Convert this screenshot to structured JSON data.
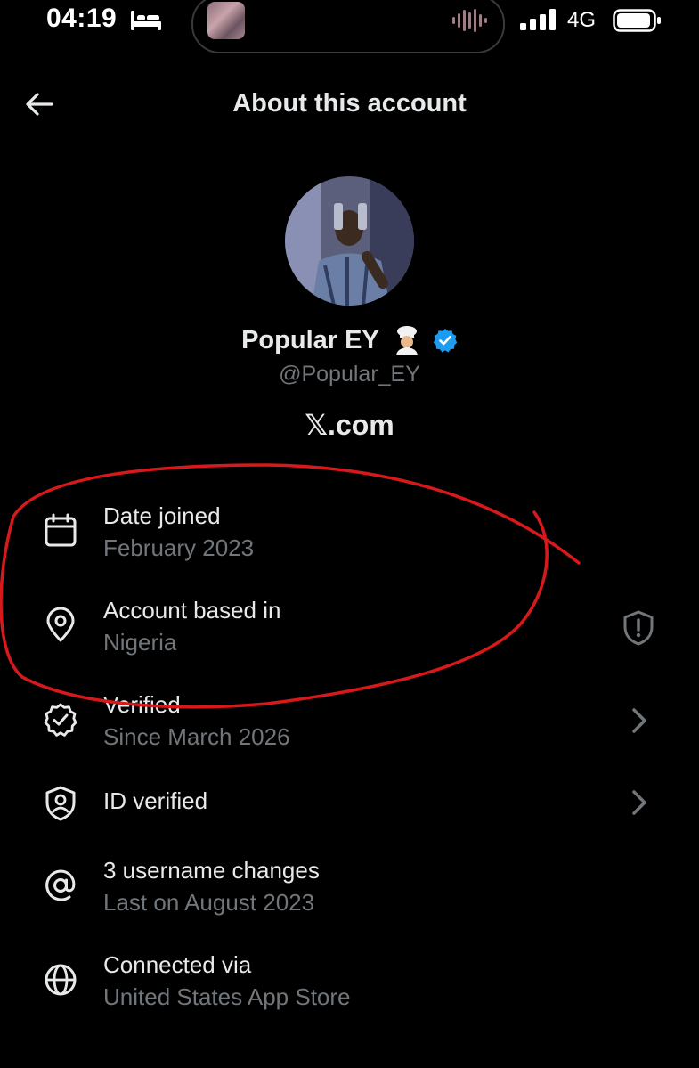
{
  "status_bar": {
    "time": "04:19",
    "network": "4G",
    "icons": [
      "bed-icon",
      "audio-wave-icon",
      "signal-bars-icon",
      "battery-icon"
    ]
  },
  "header": {
    "title": "About this account",
    "back_icon": "arrow-left-icon"
  },
  "profile": {
    "display_name": "Popular EY",
    "name_emoji": "👨🏼‍🍳",
    "handle": "@Popular_EY",
    "site": "𝕏.com",
    "verified_color": "#1d9bf0"
  },
  "details": [
    {
      "icon": "calendar-icon",
      "label": "Date joined",
      "value": "February 2023"
    },
    {
      "icon": "location-pin-icon",
      "label": "Account based in",
      "value": "Nigeria",
      "right_icon": "shield-alert-icon"
    },
    {
      "icon": "verified-check-icon",
      "label": "Verified",
      "value": "Since March 2026",
      "right_icon": "chevron-right-icon"
    },
    {
      "icon": "id-shield-icon",
      "label": "ID verified",
      "value": "",
      "right_icon": "chevron-right-icon"
    },
    {
      "icon": "at-sign-icon",
      "label": "3 username changes",
      "value": "Last on August 2023"
    },
    {
      "icon": "globe-icon",
      "label": "Connected via",
      "value": "United States App Store"
    }
  ],
  "colors": {
    "background": "#000000",
    "primary_text": "#e7e9ea",
    "secondary_text": "#71767b",
    "annotation": "#d7191c"
  }
}
